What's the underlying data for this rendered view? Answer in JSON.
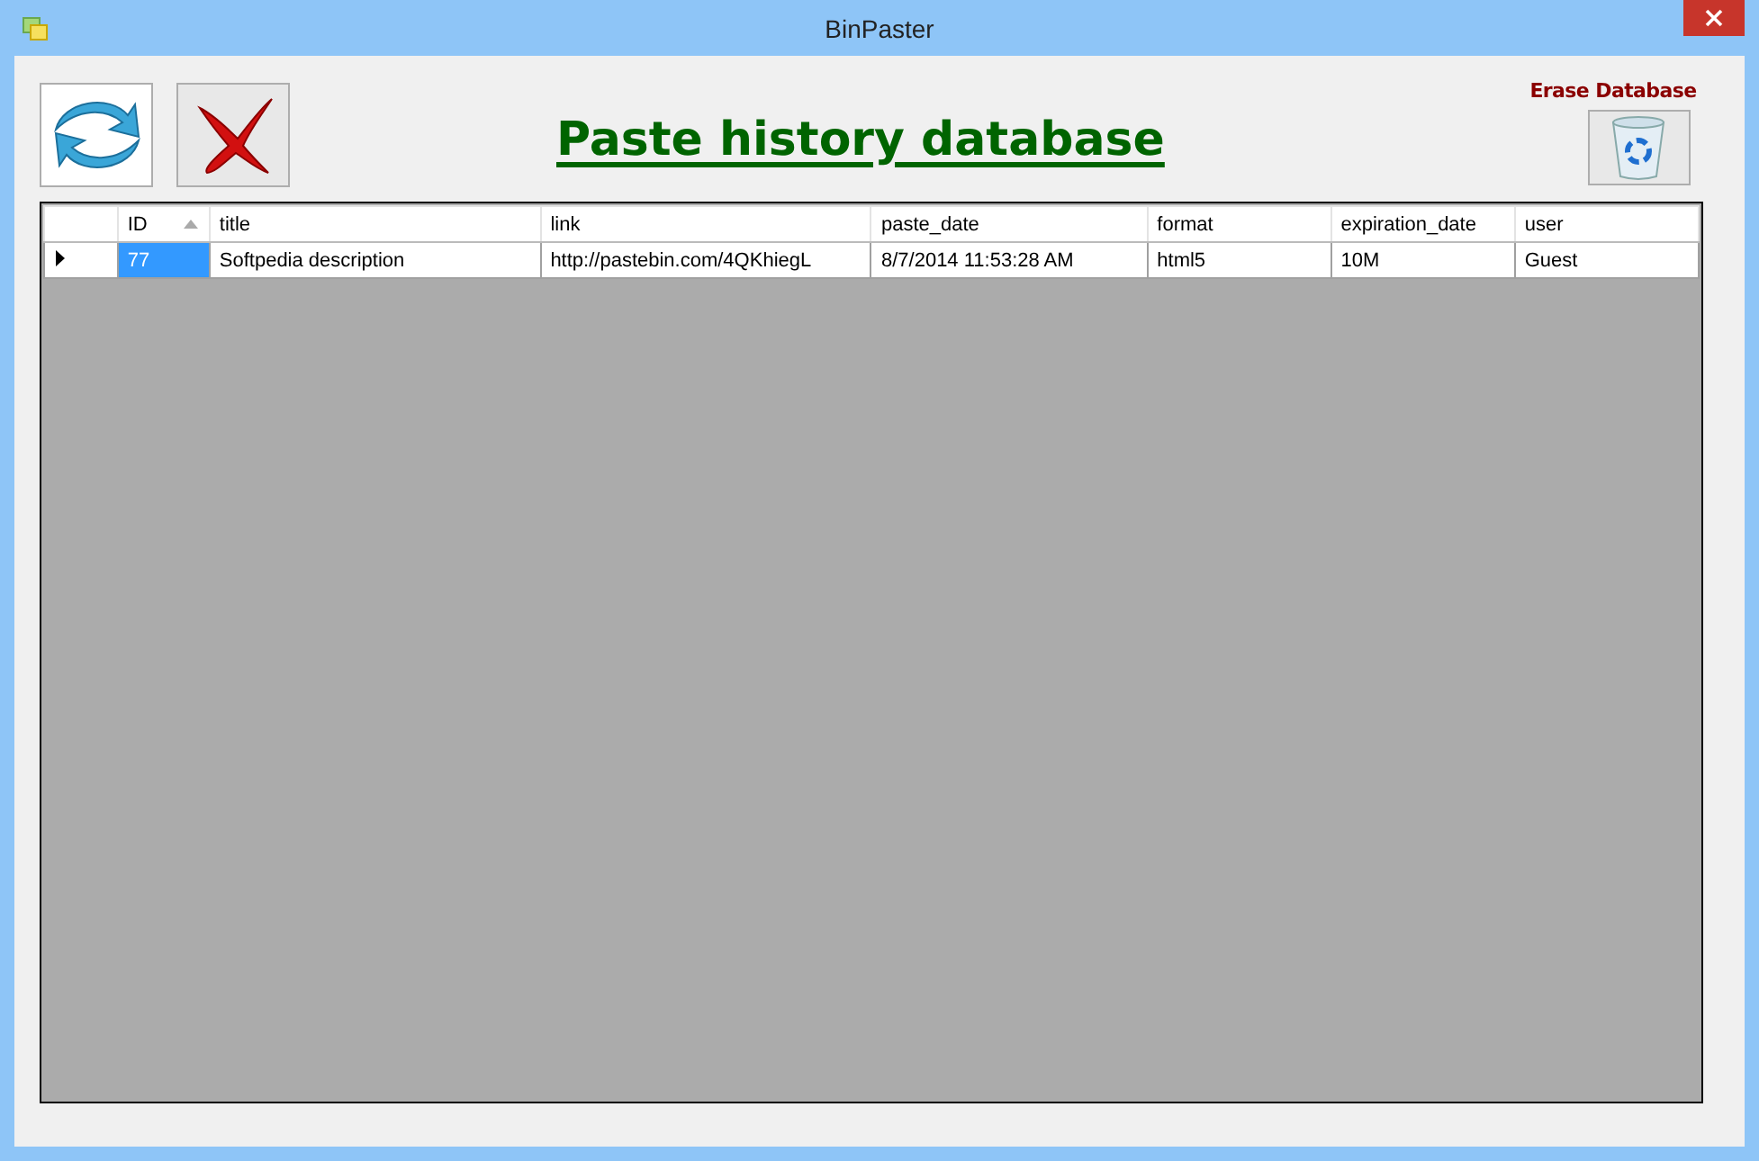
{
  "window": {
    "title": "BinPaster"
  },
  "heading": "Paste history database",
  "erase": {
    "label": "Erase Database"
  },
  "table": {
    "columns": [
      {
        "label": "ID",
        "sorted": true
      },
      {
        "label": "title",
        "sorted": false
      },
      {
        "label": "link",
        "sorted": false
      },
      {
        "label": "paste_date",
        "sorted": false
      },
      {
        "label": "format",
        "sorted": false
      },
      {
        "label": "expiration_date",
        "sorted": false
      },
      {
        "label": "user",
        "sorted": false
      }
    ],
    "rows": [
      {
        "current": true,
        "cells": [
          {
            "text": "77",
            "selected": true
          },
          {
            "text": "Softpedia description",
            "selected": false
          },
          {
            "text": "http://pastebin.com/4QKhiegL",
            "selected": false
          },
          {
            "text": "8/7/2014 11:53:28 AM",
            "selected": false
          },
          {
            "text": "html5",
            "selected": false
          },
          {
            "text": "10M",
            "selected": false
          },
          {
            "text": "Guest",
            "selected": false
          }
        ]
      }
    ]
  }
}
